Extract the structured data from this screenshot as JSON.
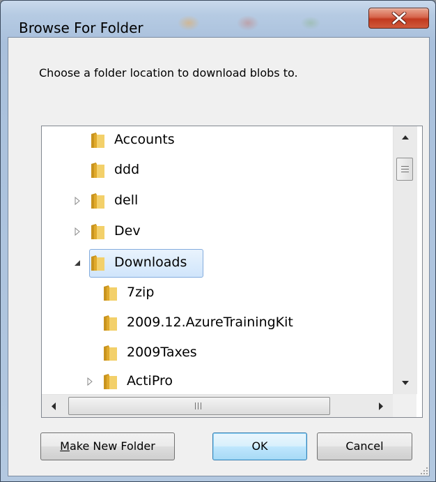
{
  "window": {
    "title": "Browse For Folder",
    "instruction": "Choose a folder location to download blobs to."
  },
  "tree": {
    "items": [
      {
        "label": "Accounts"
      },
      {
        "label": "ddd"
      },
      {
        "label": "dell"
      },
      {
        "label": "Dev"
      },
      {
        "label": "Downloads",
        "selected": true
      },
      {
        "label": "7zip"
      },
      {
        "label": "2009.12.AzureTrainingKit"
      },
      {
        "label": "2009Taxes"
      },
      {
        "label": "ActiPro"
      }
    ]
  },
  "buttons": {
    "make_new_folder_mnemonic": "M",
    "make_new_folder_rest": "ake New Folder",
    "ok": "OK",
    "cancel": "Cancel"
  },
  "icons": {
    "close": "close-icon",
    "folder": "folder-icon",
    "expander_collapsed": "expand-arrow-icon",
    "expander_expanded": "collapse-arrow-icon"
  },
  "colors": {
    "close_button": "#c9432a",
    "selection_border": "#84acdd",
    "selection_fill": "#d9eafc",
    "default_button_border": "#3c7fb1",
    "folder": "#e3b53a"
  }
}
